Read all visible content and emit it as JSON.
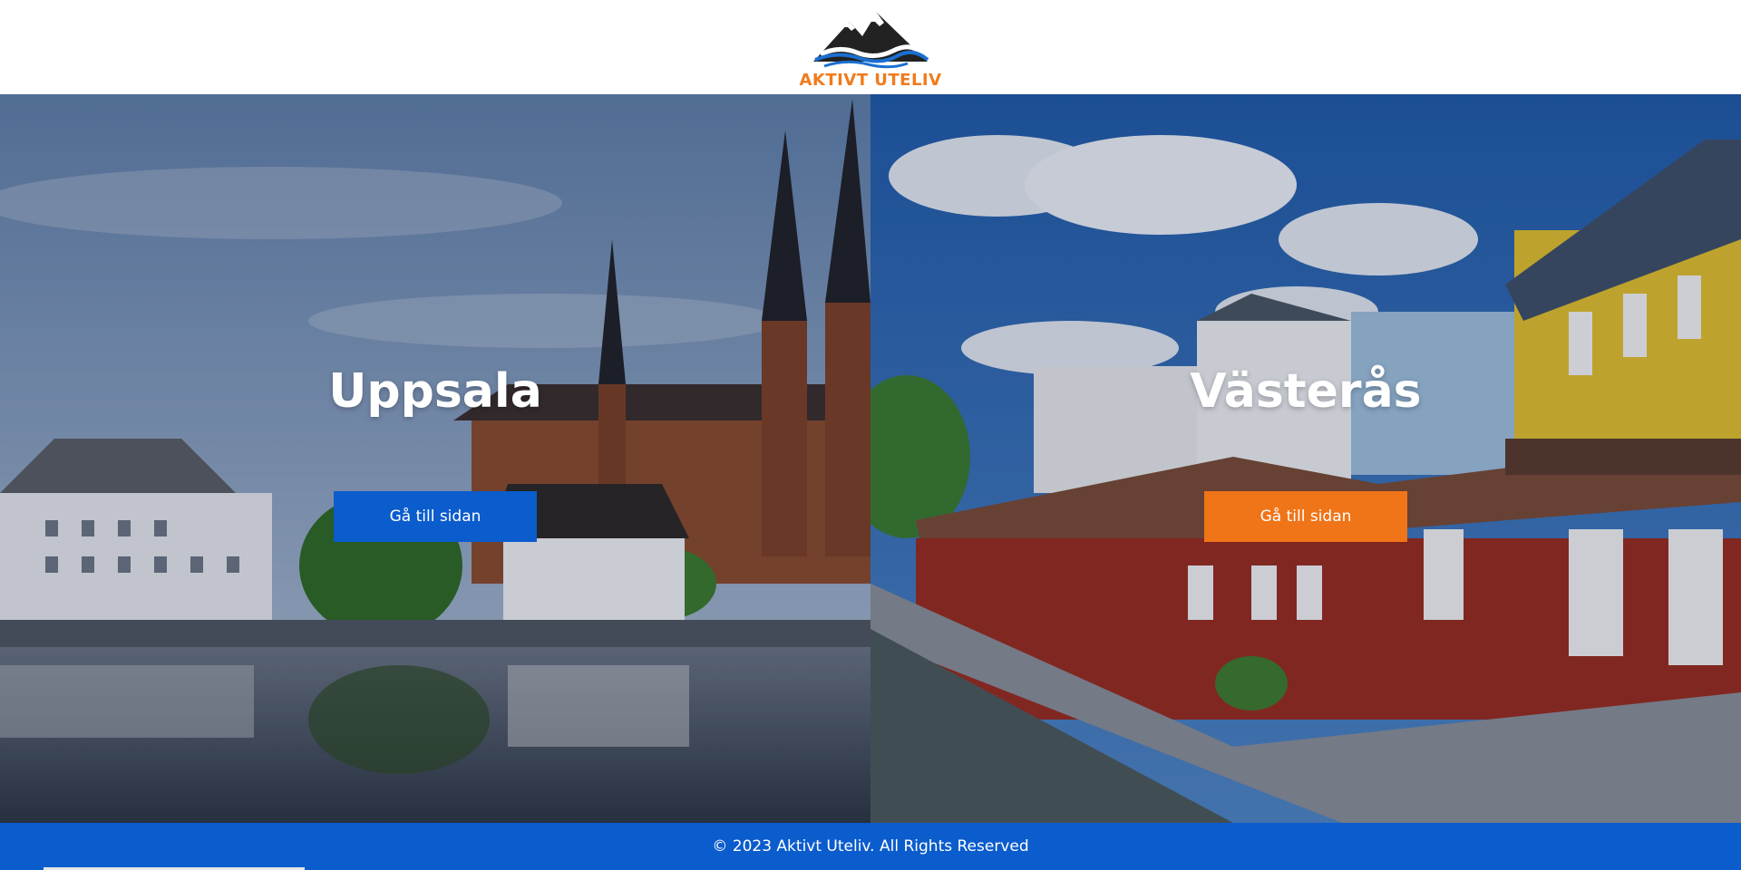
{
  "header": {
    "logo_text": "AKTIVT UTELIV",
    "logo_icon": "mountain-waves-icon"
  },
  "panels": [
    {
      "city": "Uppsala",
      "button_label": "Gå till sidan",
      "button_color": "#0b5ccd"
    },
    {
      "city": "Västerås",
      "button_label": "Gå till sidan",
      "button_color": "#f07418"
    }
  ],
  "footer": {
    "text": "© 2023 Aktivt Uteliv. All Rights Reserved"
  },
  "colors": {
    "brand_orange": "#f07b1d",
    "brand_blue": "#0b5ccd"
  }
}
